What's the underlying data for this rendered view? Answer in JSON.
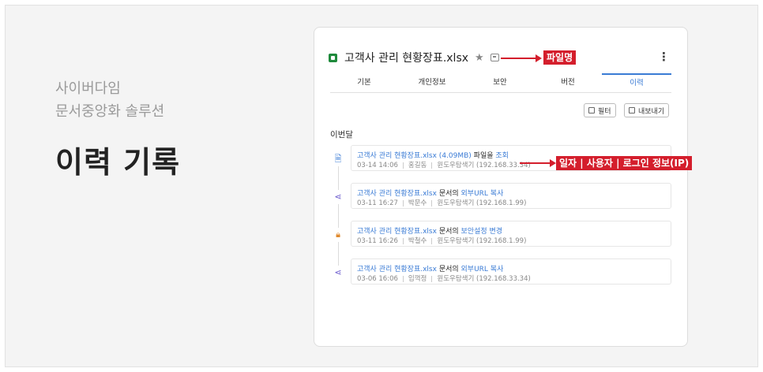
{
  "left": {
    "line1": "사이버다임",
    "line2": "문서중앙화 솔루션",
    "title": "이력 기록"
  },
  "file": {
    "name": "고객사 관리 현황장표.xlsx",
    "label_filename": "파일명"
  },
  "tabs": [
    {
      "label": "기본"
    },
    {
      "label": "개인정보"
    },
    {
      "label": "보안"
    },
    {
      "label": "버전"
    },
    {
      "label": "이력"
    }
  ],
  "toolbar": {
    "filter_label": "필터",
    "export_label": "내보내기"
  },
  "section_label": "이번달",
  "meta_label": "일자 | 사용자 | 로그인 정보(IP)",
  "items": [
    {
      "file": "고객사 관리 현황장표.xlsx (4.09MB)",
      "mid": " 파일을 ",
      "action": "조회",
      "date": "03-14 14:06",
      "user": "홍길동",
      "ip": "윈도우탐색기 (192.168.33.34)",
      "icon": "document-icon"
    },
    {
      "file": "고객사 관리 현황장표.xlsx",
      "mid": " 문서의 ",
      "action": "외부URL 복사",
      "date": "03-11 16:27",
      "user": "박문수",
      "ip": "윈도우탐색기 (192.168.1.99)",
      "icon": "share-icon"
    },
    {
      "file": "고객사 관리 현황장표.xlsx",
      "mid": " 문서의 ",
      "action": "보안설정 변경",
      "date": "03-11 16:26",
      "user": "박철수",
      "ip": "윈도우탐색기 (192.168.1.99)",
      "icon": "lock-icon"
    },
    {
      "file": "고객사 관리 현황장표.xlsx",
      "mid": " 문서의 ",
      "action": "외부URL 복사",
      "date": "03-06 16:06",
      "user": "임꺽정",
      "ip": "윈도우탐색기 (192.168.33.34)",
      "icon": "share-icon"
    }
  ],
  "colors": {
    "accent": "#3a7bd5",
    "highlight": "#d41e2c"
  }
}
